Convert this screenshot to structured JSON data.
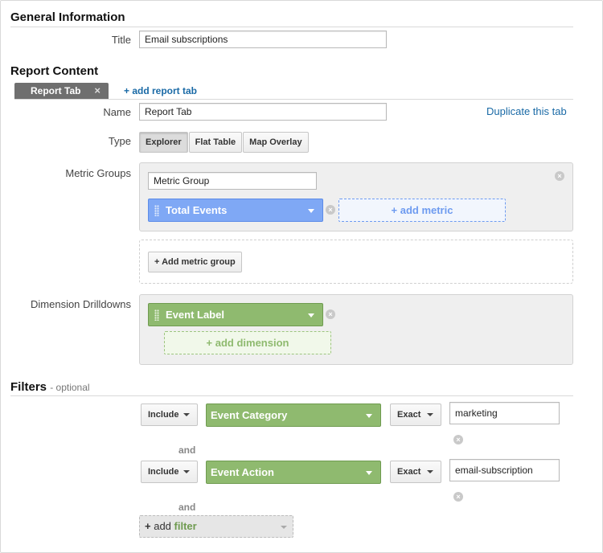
{
  "general": {
    "heading": "General Information",
    "title_label": "Title",
    "title_value": "Email subscriptions"
  },
  "report_content": {
    "heading": "Report Content",
    "active_tab": "Report Tab",
    "tab_close": "×",
    "add_tab_link": "+ add report tab",
    "name_label": "Name",
    "name_value": "Report Tab",
    "duplicate_link": "Duplicate this tab",
    "type_label": "Type",
    "type_options": [
      "Explorer",
      "Flat Table",
      "Map Overlay"
    ],
    "type_selected": "Explorer",
    "metric_groups_label": "Metric Groups",
    "metric_group_name": "Metric Group",
    "metric_chip": "Total Events",
    "add_metric": "+ add metric",
    "add_metric_group": "+ Add metric group",
    "dimension_label": "Dimension Drilldowns",
    "dimension_chip": "Event Label",
    "add_dimension": "+ add dimension",
    "remove_glyph": "×"
  },
  "filters": {
    "heading": "Filters",
    "optional": "- optional",
    "rows": [
      {
        "mode": "Include",
        "dimension": "Event Category",
        "match": "Exact",
        "value": "marketing"
      },
      {
        "mode": "Include",
        "dimension": "Event Action",
        "match": "Exact",
        "value": "email-subscription"
      }
    ],
    "and_label": "and",
    "add_filter_plus": "+",
    "add_filter_word": "add",
    "add_filter_kw": "filter"
  },
  "colors": {
    "link": "#1a6aa6",
    "metric_chip": "#7fa8f5",
    "dimension_chip": "#8fba6f",
    "tab_active": "#6f6f6f"
  }
}
